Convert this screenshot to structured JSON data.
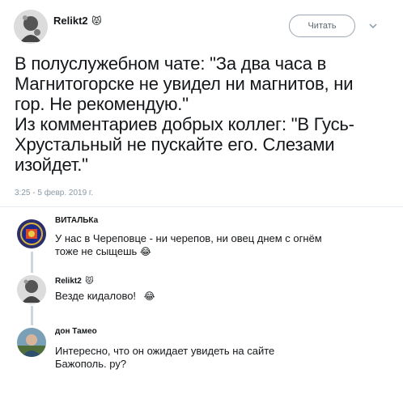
{
  "tweet": {
    "author_name": "Relikt2",
    "author_badge": "😾",
    "follow_label": "Читать",
    "text_lines": [
      "В полуслужебном чате: \"За два часа в",
      "Магнитогорске не увидел ни магнитов, ни",
      "гор. Не рекомендую.\"",
      "Из комментариев добрых коллег: \"В Гусь-",
      "Хрустальный не пускайте его. Слезами",
      "изойдет.\""
    ],
    "timestamp": "3:25 - 5 февр. 2019 г."
  },
  "replies": [
    {
      "author_name": "ВИТАЛЬКа",
      "lines": [
        "У нас в Череповце - ни черепов, ни овец днем с огнём",
        "тоже не сыщешь"
      ],
      "emoji": "😂"
    },
    {
      "author_name": "Relikt2",
      "author_badge": "😾",
      "lines": [
        "Везде кидалово!"
      ],
      "emoji": "😂"
    },
    {
      "author_name": "дон Тамео",
      "lines": [
        "Интересно, что он ожидает увидеть на сайте",
        "Бажополь. ру?"
      ]
    }
  ],
  "icons": {
    "main_avatar": "avatar-icon",
    "chevron": "chevron-down-icon"
  },
  "colors": {
    "text": "#14171a",
    "secondary": "#8899a6",
    "thread_line": "#ccd6dd",
    "button_border": "#9aa6b1"
  }
}
